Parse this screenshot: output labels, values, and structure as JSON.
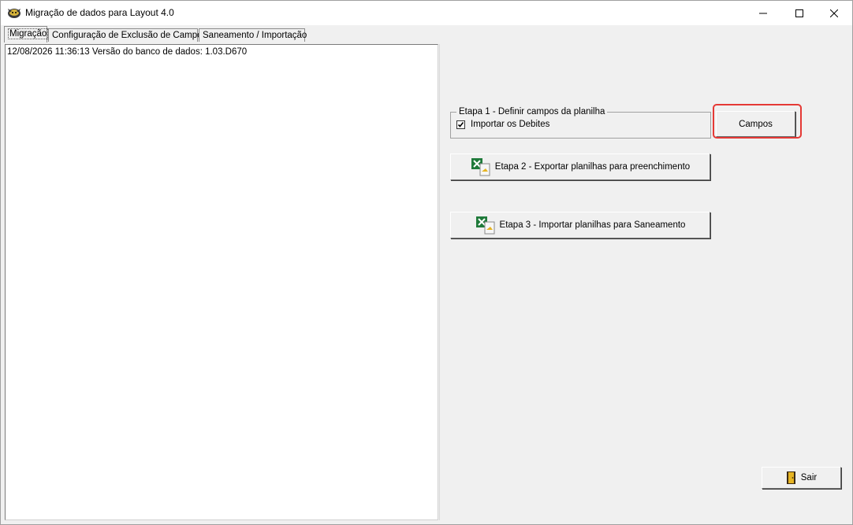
{
  "window": {
    "title": "Migração de dados para Layout 4.0"
  },
  "tabs": [
    {
      "label": "Migração",
      "active": true
    },
    {
      "label": "Configuração de Exclusão de Campos",
      "active": false
    },
    {
      "label": "Saneamento / Importação",
      "active": false
    }
  ],
  "log": {
    "lines": [
      "12/08/2026 11:36:13 Versão do banco de dados: 1.03.D670"
    ]
  },
  "etapa1": {
    "group_label": "Etapa 1 - Definir campos da planilha",
    "checkbox_label": "Importar os Debites",
    "checkbox_checked": true,
    "campos_button": "Campos"
  },
  "etapa2": {
    "button": "Etapa 2 - Exportar planilhas para preenchimento",
    "icon": "excel-export-icon"
  },
  "etapa3": {
    "button": "Etapa 3 - Importar planilhas para Saneamento",
    "icon": "excel-import-icon"
  },
  "sair": {
    "button": "Sair",
    "icon": "exit-door-icon"
  },
  "colors": {
    "highlight": "#e53935",
    "excel_green": "#1f7a3a"
  }
}
